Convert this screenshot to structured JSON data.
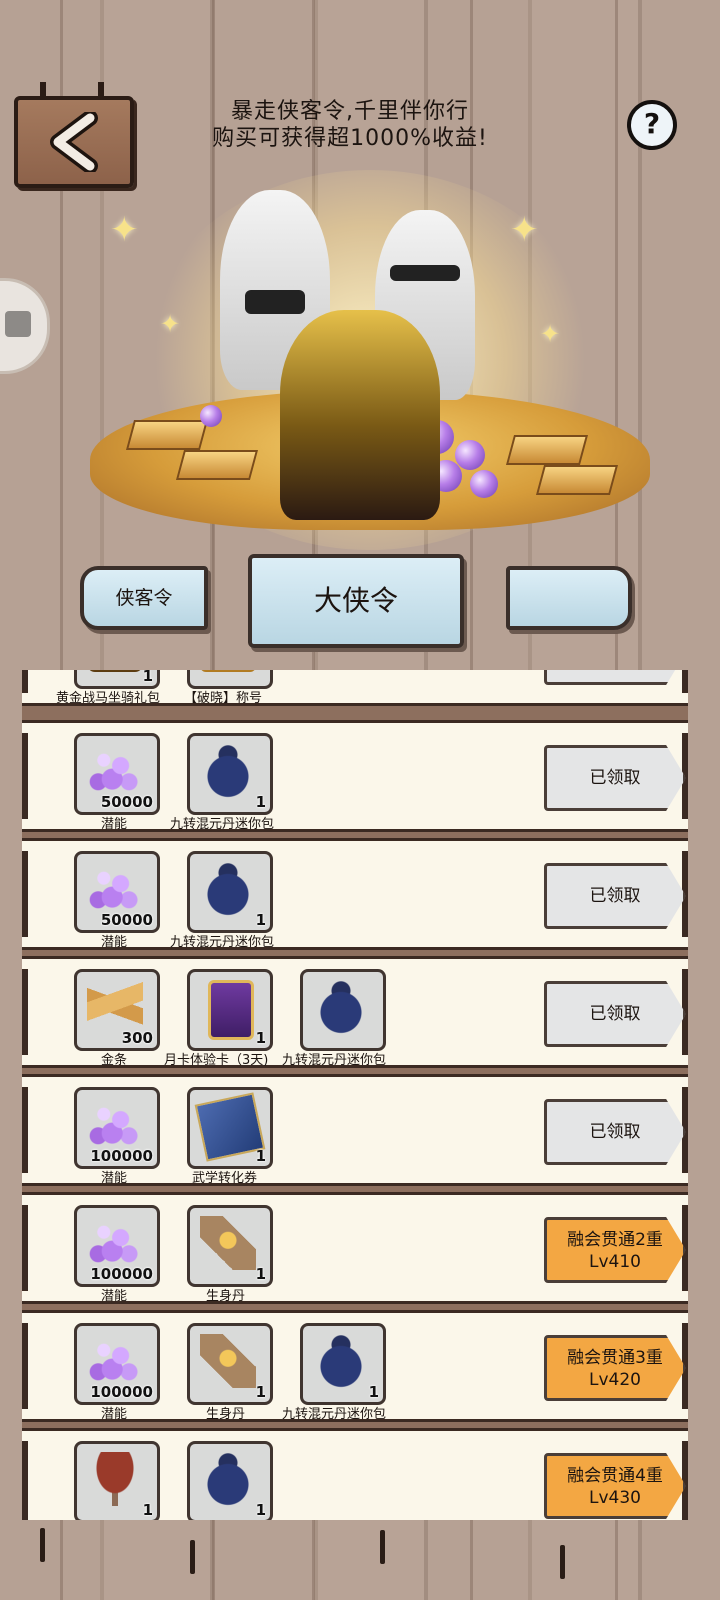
{
  "header": {
    "title_line1": "暴走侠客令,千里伴你行",
    "title_line2": "购买可获得超1000%收益!",
    "help_label": "?"
  },
  "tiers": {
    "left_label": "侠客令",
    "active_label": "大侠令",
    "right_label": ""
  },
  "rows": [
    {
      "items": [
        {
          "name": "黄金战马坐骑礼包",
          "qty": "1",
          "icon": "golden-horse-icon"
        },
        {
          "name": "【破晓】称号",
          "qty": "",
          "icon": "title-badge-icon"
        }
      ],
      "button": {
        "label": "",
        "sub": "",
        "state": "claimed"
      }
    },
    {
      "items": [
        {
          "name": "潜能",
          "qty": "50000",
          "icon": "potential-orbs-icon"
        },
        {
          "name": "九转混元丹迷你包",
          "qty": "1",
          "icon": "pill-pouch-icon"
        }
      ],
      "button": {
        "label": "已领取",
        "sub": "",
        "state": "claimed"
      }
    },
    {
      "items": [
        {
          "name": "潜能",
          "qty": "50000",
          "icon": "potential-orbs-icon"
        },
        {
          "name": "九转混元丹迷你包",
          "qty": "1",
          "icon": "pill-pouch-icon"
        }
      ],
      "button": {
        "label": "已领取",
        "sub": "",
        "state": "claimed"
      }
    },
    {
      "items": [
        {
          "name": "金条",
          "qty": "300",
          "icon": "gold-bar-icon"
        },
        {
          "name": "月卡体验卡（3天)",
          "qty": "1",
          "icon": "month-card-icon"
        },
        {
          "name": "九转混元丹迷你包",
          "qty": "",
          "icon": "pill-pouch-icon"
        }
      ],
      "button": {
        "label": "已领取",
        "sub": "",
        "state": "claimed"
      }
    },
    {
      "items": [
        {
          "name": "潜能",
          "qty": "100000",
          "icon": "potential-orbs-icon"
        },
        {
          "name": "武学转化券",
          "qty": "1",
          "icon": "martial-voucher-icon"
        }
      ],
      "button": {
        "label": "已领取",
        "sub": "",
        "state": "claimed"
      }
    },
    {
      "items": [
        {
          "name": "潜能",
          "qty": "100000",
          "icon": "potential-orbs-icon"
        },
        {
          "name": "生身丹",
          "qty": "1",
          "icon": "elixir-pill-icon"
        }
      ],
      "button": {
        "label": "融会贯通2重",
        "sub": "Lv410",
        "state": "locked"
      }
    },
    {
      "items": [
        {
          "name": "潜能",
          "qty": "100000",
          "icon": "potential-orbs-icon"
        },
        {
          "name": "生身丹",
          "qty": "1",
          "icon": "elixir-pill-icon"
        },
        {
          "name": "九转混元丹迷你包",
          "qty": "1",
          "icon": "pill-pouch-icon"
        }
      ],
      "button": {
        "label": "融会贯通3重",
        "sub": "Lv420",
        "state": "locked"
      }
    },
    {
      "items": [
        {
          "name": "",
          "qty": "1",
          "icon": "lingzhi-herb-icon"
        },
        {
          "name": "",
          "qty": "1",
          "icon": "pill-pouch-icon"
        }
      ],
      "button": {
        "label": "融会贯通4重",
        "sub": "Lv430",
        "state": "locked"
      }
    }
  ],
  "colors": {
    "background": "#b39e91",
    "row_bg": "#fbf7ea",
    "claimed_btn": "#e4e5e6",
    "locked_btn": "#f3a743",
    "tier_btn": "#dceef6"
  }
}
